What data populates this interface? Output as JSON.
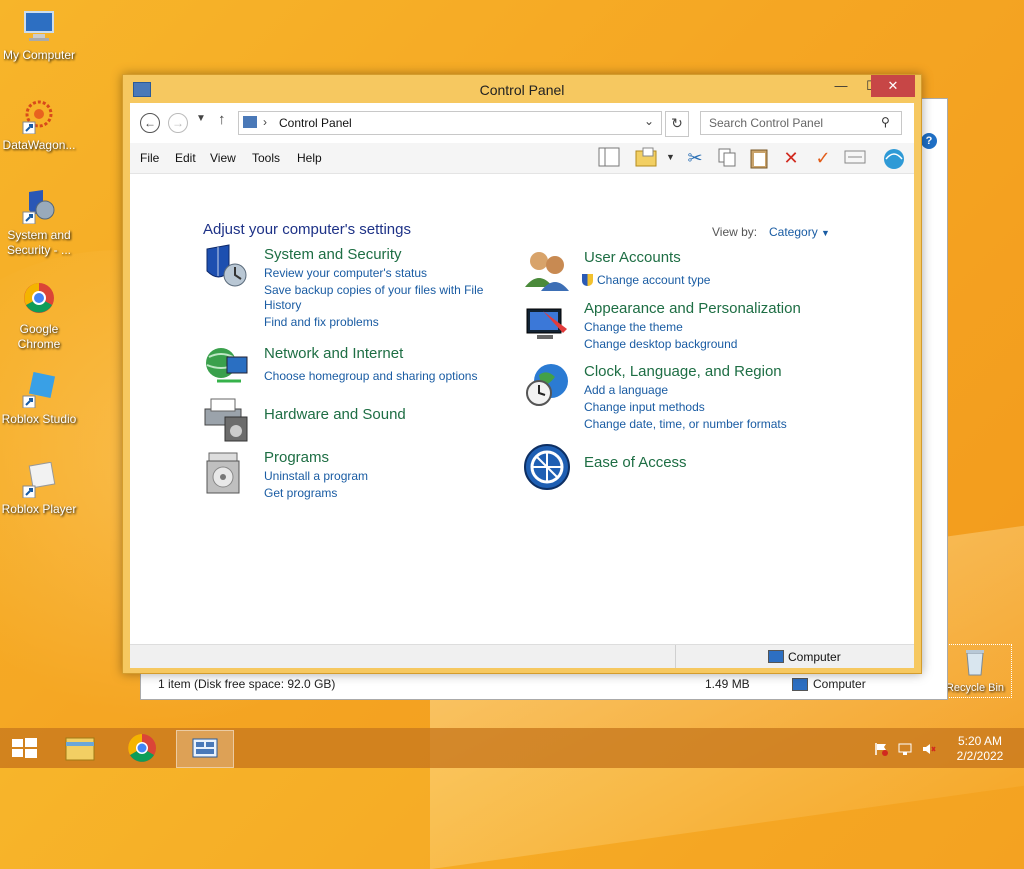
{
  "desktop": {
    "icons": [
      {
        "label": "My Computer"
      },
      {
        "label": "DataWagon..."
      },
      {
        "label": "System and Security - ..."
      },
      {
        "label": "Google Chrome"
      },
      {
        "label": "Roblox Studio"
      },
      {
        "label": "Roblox Player"
      },
      {
        "label": "Recycle Bin"
      }
    ]
  },
  "bg_window": {
    "status_items": "1 item (Disk free space: 92.0 GB)",
    "status_size": "1.49 MB",
    "status_location": "Computer"
  },
  "window": {
    "title": "Control Panel",
    "min_label": "—",
    "max_label": "☐",
    "close_label": "✕",
    "address": {
      "breadcrumb": "Control Panel"
    },
    "search": {
      "placeholder": "Search Control Panel"
    },
    "menu": [
      "File",
      "Edit",
      "View",
      "Tools",
      "Help"
    ],
    "heading": "Adjust your computer's settings",
    "view_by_label": "View by:",
    "view_by_value": "Category",
    "categories": {
      "system_security": {
        "title": "System and Security",
        "links": [
          "Review your computer's status",
          "Save backup copies of your files with File",
          "History",
          "Find and fix problems"
        ]
      },
      "network": {
        "title": "Network and Internet",
        "links": [
          "Choose homegroup and sharing options"
        ]
      },
      "hardware": {
        "title": "Hardware and Sound",
        "links": []
      },
      "programs": {
        "title": "Programs",
        "links": [
          "Uninstall a program",
          "Get programs"
        ]
      },
      "user_accounts": {
        "title": "User Accounts",
        "links": [
          "Change account type"
        ]
      },
      "appearance": {
        "title": "Appearance and Personalization",
        "links": [
          "Change the theme",
          "Change desktop background"
        ]
      },
      "clock": {
        "title": "Clock, Language, and Region",
        "links": [
          "Add a language",
          "Change input methods",
          "Change date, time, or number formats"
        ]
      },
      "ease": {
        "title": "Ease of Access",
        "links": []
      }
    },
    "status_location": "Computer"
  },
  "taskbar": {
    "time": "5:20 AM",
    "date": "2/2/2022"
  }
}
